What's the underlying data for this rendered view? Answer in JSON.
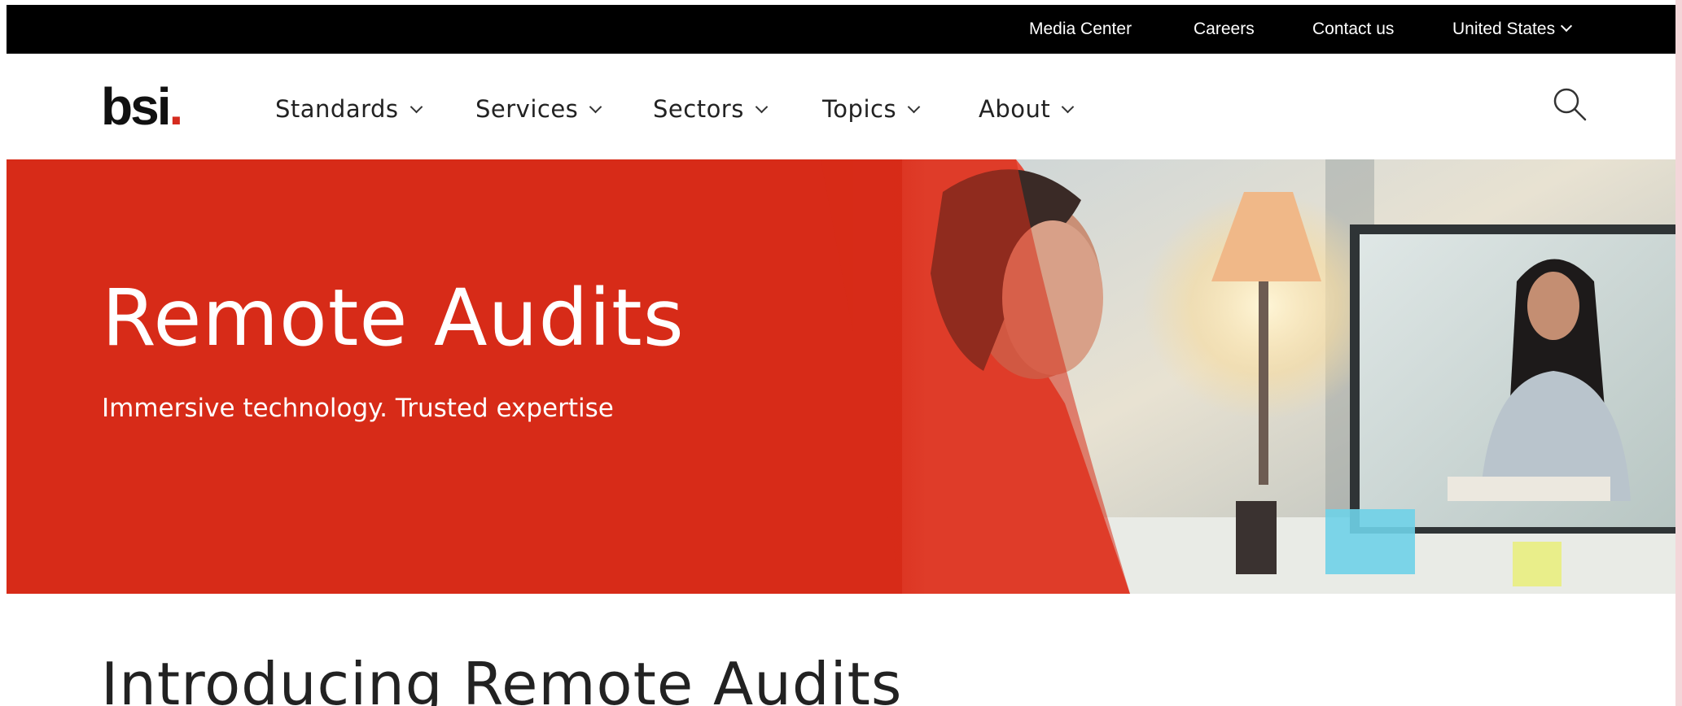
{
  "utility_bar": {
    "links": [
      {
        "label": "Media Center"
      },
      {
        "label": "Careers"
      },
      {
        "label": "Contact us"
      },
      {
        "label": "United States"
      }
    ]
  },
  "header": {
    "logo_text": "bsi",
    "logo_dot": ".",
    "nav": [
      {
        "label": "Standards"
      },
      {
        "label": "Services"
      },
      {
        "label": "Sectors"
      },
      {
        "label": "Topics"
      },
      {
        "label": "About"
      }
    ],
    "search_icon": "search-icon"
  },
  "hero": {
    "title": "Remote Audits",
    "subtitle": "Immersive technology. Trusted expertise",
    "background_color": "#d72b18"
  },
  "main": {
    "section_heading": "Introducing Remote Audits"
  },
  "colors": {
    "brand_red": "#d52b1e",
    "utility_bar": "#000000",
    "text_dark": "#222222"
  }
}
